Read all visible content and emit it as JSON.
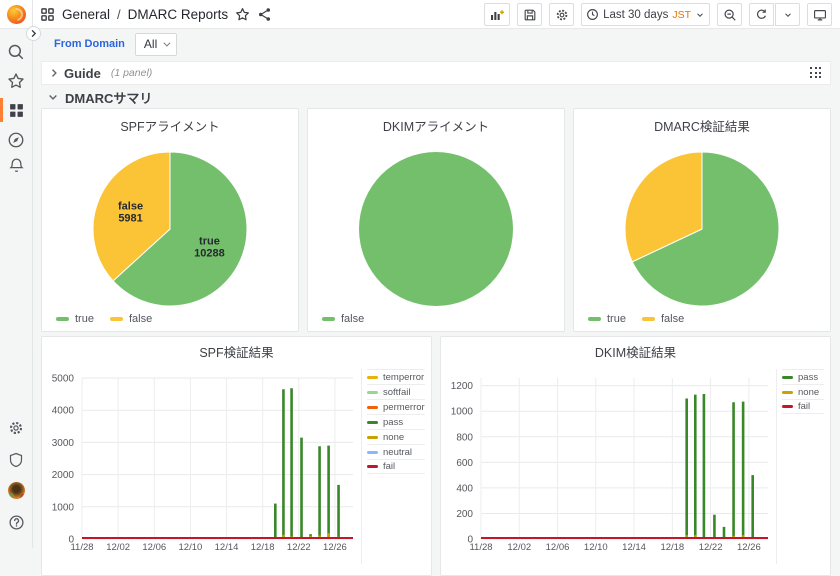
{
  "navbar": {
    "breadcrumb": {
      "folder": "General",
      "separator": "/",
      "title": "DMARC Reports"
    },
    "time_picker": {
      "label": "Last 30 days",
      "timezone": "JST"
    }
  },
  "submenu": {
    "filter_label": "From Domain",
    "filter_value": "All"
  },
  "rows": {
    "guide": {
      "label": "Guide",
      "meta": "(1 panel)"
    },
    "summary": {
      "label": "DMARCサマリ"
    }
  },
  "colors": {
    "accent_orange": "#ff8033",
    "link_blue": "#2c65de",
    "pie_green": "#74bf6c",
    "pie_yellow": "#fbc437",
    "pass_green": "#388729",
    "fail_red": "#c4162a",
    "none_gold": "#c9a100"
  },
  "icons": [
    "grafana-logo",
    "search",
    "star",
    "dashboards-grid",
    "compass",
    "bell",
    "gear",
    "shield",
    "avatar",
    "help",
    "apps",
    "share",
    "panel-add",
    "save",
    "clock",
    "zoom-out",
    "refresh",
    "chevron-down",
    "tv",
    "drag-grip"
  ],
  "chart_data": [
    {
      "type": "pie",
      "title": "SPFアライメント",
      "legend_position": "bottom",
      "slices": [
        {
          "label": "true",
          "value": 10288,
          "color": "#74bf6c",
          "show_label": true
        },
        {
          "label": "false",
          "value": 5981,
          "color": "#fbc437",
          "show_label": true
        }
      ]
    },
    {
      "type": "pie",
      "title": "DKIMアライメント",
      "legend_position": "bottom",
      "slices": [
        {
          "label": "false",
          "value": 100,
          "color": "#74bf6c",
          "show_label": false
        }
      ]
    },
    {
      "type": "pie",
      "title": "DMARC検証結果",
      "legend_position": "bottom",
      "slices": [
        {
          "label": "true",
          "value": 68,
          "color": "#74bf6c",
          "show_label": false
        },
        {
          "label": "false",
          "value": 32,
          "color": "#fbc437",
          "show_label": false
        }
      ]
    },
    {
      "type": "bar",
      "title": "SPF検証結果",
      "ylim": [
        0,
        5000
      ],
      "yticks": [
        0,
        1000,
        2000,
        3000,
        4000,
        5000
      ],
      "x_days": 30,
      "xticks": [
        {
          "day": 0,
          "label": "11/28"
        },
        {
          "day": 4,
          "label": "12/02"
        },
        {
          "day": 8,
          "label": "12/06"
        },
        {
          "day": 12,
          "label": "12/10"
        },
        {
          "day": 16,
          "label": "12/14"
        },
        {
          "day": 20,
          "label": "12/18"
        },
        {
          "day": 24,
          "label": "12/22"
        },
        {
          "day": 28,
          "label": "12/26"
        }
      ],
      "legend_position": "right",
      "series": [
        {
          "name": "temperror",
          "color": "#e8b20c",
          "points": []
        },
        {
          "name": "softfail",
          "color": "#96d98d",
          "points": []
        },
        {
          "name": "permerror",
          "color": "#f2600a",
          "points": []
        },
        {
          "name": "pass",
          "color": "#388729",
          "points": [
            [
              21.4,
              1100
            ],
            [
              22.3,
              4650
            ],
            [
              23.2,
              4680
            ],
            [
              24.3,
              3150
            ],
            [
              25.3,
              150
            ],
            [
              26.3,
              2880
            ],
            [
              27.3,
              2900
            ],
            [
              28.4,
              1680
            ]
          ]
        },
        {
          "name": "none",
          "color": "#c9a100",
          "points": [
            [
              21.4,
              60
            ],
            [
              22.3,
              130
            ],
            [
              23.2,
              80
            ],
            [
              24.3,
              60
            ],
            [
              25.3,
              90
            ],
            [
              26.3,
              110
            ],
            [
              27.3,
              180
            ],
            [
              28.4,
              70
            ]
          ]
        },
        {
          "name": "neutral",
          "color": "#8ab8ff",
          "points": []
        },
        {
          "name": "fail",
          "color": "#c4162a",
          "points": [],
          "baseline": 0
        }
      ]
    },
    {
      "type": "bar",
      "title": "DKIM検証結果",
      "ylim": [
        0,
        1260
      ],
      "yticks": [
        0,
        200,
        400,
        600,
        800,
        1000,
        1200
      ],
      "x_days": 30,
      "xticks": [
        {
          "day": 0,
          "label": "11/28"
        },
        {
          "day": 4,
          "label": "12/02"
        },
        {
          "day": 8,
          "label": "12/06"
        },
        {
          "day": 12,
          "label": "12/10"
        },
        {
          "day": 16,
          "label": "12/14"
        },
        {
          "day": 20,
          "label": "12/18"
        },
        {
          "day": 24,
          "label": "12/22"
        },
        {
          "day": 28,
          "label": "12/26"
        }
      ],
      "legend_position": "right",
      "series": [
        {
          "name": "pass",
          "color": "#388729",
          "points": [
            [
              21.5,
              1100
            ],
            [
              22.4,
              1130
            ],
            [
              23.3,
              1135
            ],
            [
              24.4,
              190
            ],
            [
              25.4,
              95
            ],
            [
              26.4,
              1070
            ],
            [
              27.4,
              1075
            ],
            [
              28.4,
              500
            ]
          ]
        },
        {
          "name": "none",
          "color": "#c9a100",
          "points": [
            [
              21.5,
              30
            ],
            [
              22.4,
              30
            ],
            [
              26.4,
              25
            ],
            [
              27.4,
              30
            ]
          ]
        },
        {
          "name": "fail",
          "color": "#c4162a",
          "points": [],
          "baseline": 0
        }
      ]
    }
  ]
}
